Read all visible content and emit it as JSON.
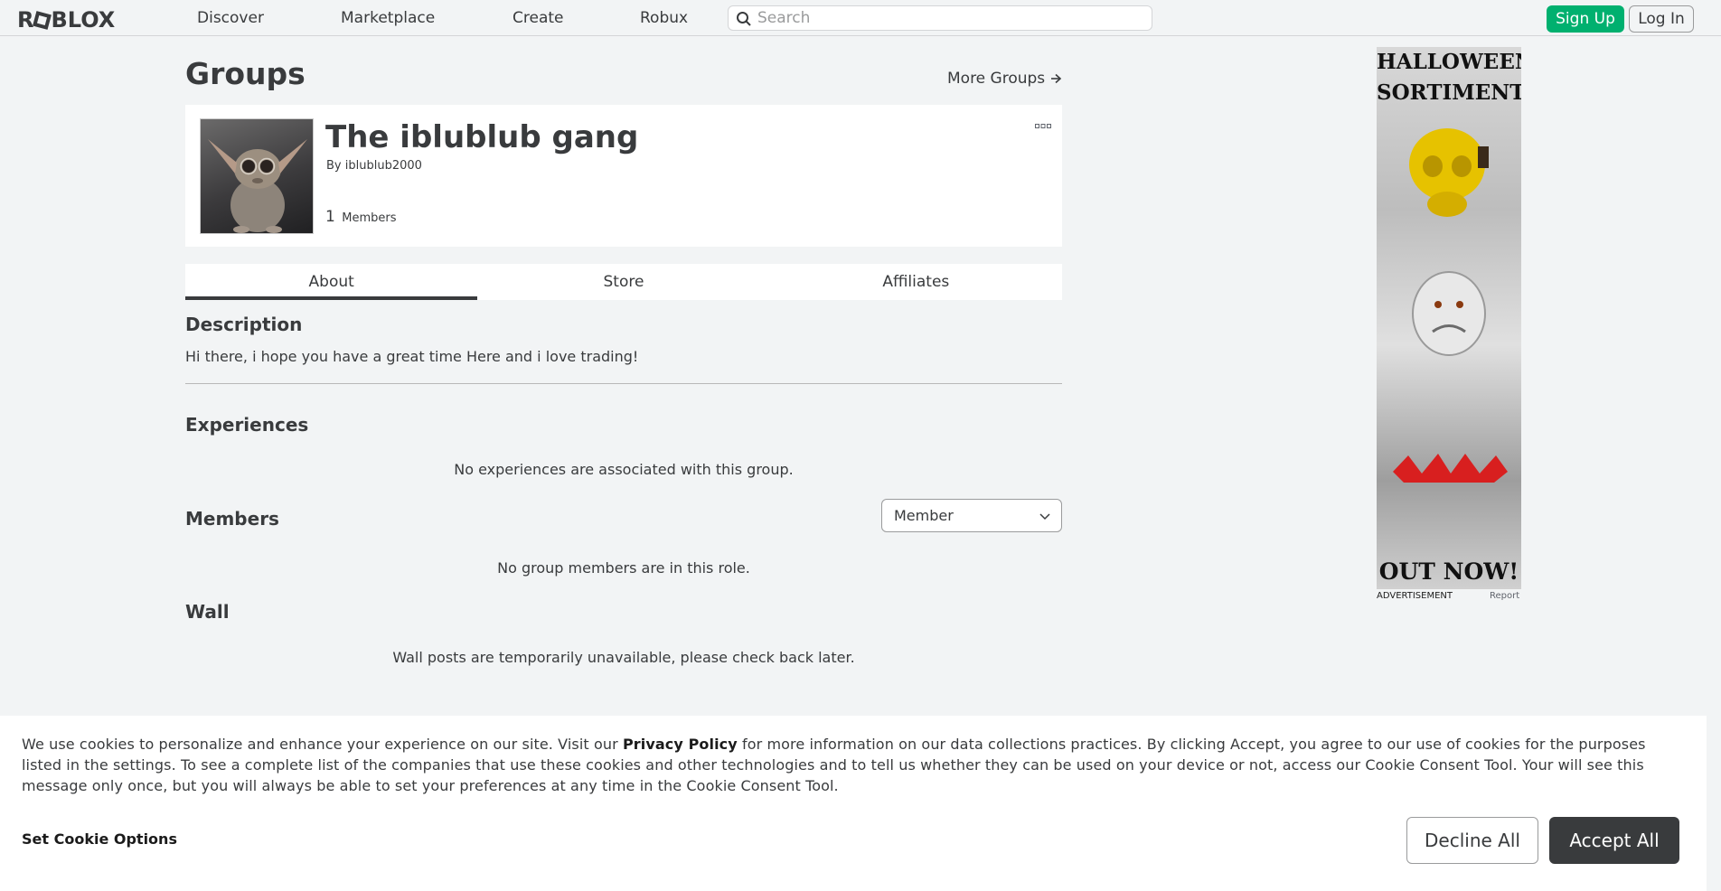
{
  "nav": {
    "logo": "RBLOX",
    "links": [
      "Discover",
      "Marketplace",
      "Create",
      "Robux"
    ],
    "search_placeholder": "Search",
    "signup": "Sign Up",
    "login": "Log In"
  },
  "page": {
    "title": "Groups",
    "more_groups": "More Groups"
  },
  "group": {
    "name": "The iblublub gang",
    "owner_prefix": "By",
    "owner": "iblublub2000",
    "member_count": "1",
    "member_label": "Members"
  },
  "tabs": [
    "About",
    "Store",
    "Affiliates"
  ],
  "active_tab": "About",
  "about": {
    "description_title": "Description",
    "description": "Hi there, i hope you have a great time Here and i love trading!",
    "experiences_title": "Experiences",
    "experiences_empty": "No experiences are associated with this group.",
    "members_title": "Members",
    "role_selected": "Member",
    "members_empty": "No group members are in this role.",
    "wall_title": "Wall",
    "wall_message": "Wall posts are temporarily unavailable, please check back later."
  },
  "ad": {
    "headline": "HALLOWEEN SORTIMENT",
    "footer": "OUT NOW!",
    "label": "ADVERTISEMENT",
    "report": "Report"
  },
  "cookie": {
    "text_before": "We use cookies to personalize and enhance your experience on our site. Visit our",
    "link": "Privacy Policy",
    "text_after": "for more information on our data collections practices. By clicking Accept, you agree to our use of cookies for the purposes listed in the settings. To see a complete list of the companies that use these cookies and other technologies and to tell us whether they can be used on your device or not, access our Cookie Consent Tool. Your will see this message only once, but you will always be able to set your preferences at any time in the Cookie Consent Tool.",
    "set_options": "Set Cookie Options",
    "decline": "Decline All",
    "accept": "Accept All"
  },
  "colors": {
    "accent_green": "#00b06f",
    "text": "#393b3d",
    "background": "#f2f4f5"
  }
}
